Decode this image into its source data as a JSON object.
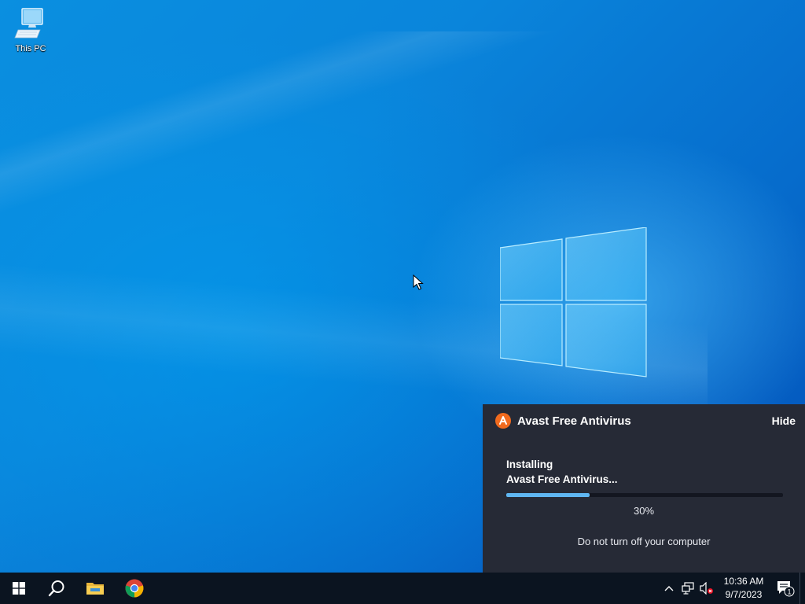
{
  "desktop": {
    "icons": [
      {
        "label": "This PC",
        "icon": "computer-icon"
      }
    ]
  },
  "notification": {
    "app_title": "Avast Free Antivirus",
    "hide_label": "Hide",
    "status_line1": "Installing",
    "status_line2": "Avast Free Antivirus...",
    "progress_percent": 30,
    "percent_text": "30%",
    "warning_text": "Do not turn off your computer",
    "colors": {
      "background": "#262a36",
      "progress": "#5fb6f2",
      "brand": "#f06a1e"
    }
  },
  "taskbar": {
    "pinned": [
      {
        "name": "start",
        "icon": "windows-start-icon"
      },
      {
        "name": "search",
        "icon": "search-icon"
      },
      {
        "name": "file-explorer",
        "icon": "folder-icon"
      },
      {
        "name": "chrome",
        "icon": "chrome-icon"
      }
    ],
    "tray": {
      "icons": [
        "chevron-up-icon",
        "network-icon",
        "volume-muted-icon"
      ],
      "time": "10:36 AM",
      "date": "9/7/2023",
      "notification_count": "1"
    }
  }
}
